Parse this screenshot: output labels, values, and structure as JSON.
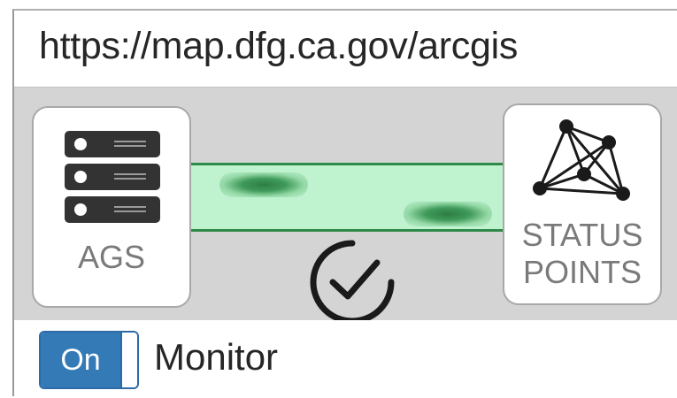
{
  "url_bar": {
    "text": "https://map.dfg.ca.gov/arcgis"
  },
  "diagram": {
    "source_node": {
      "label": "AGS",
      "icon": "server-stack-icon"
    },
    "target_node": {
      "label_line1": "STATUS",
      "label_line2": "POINTS",
      "icon": "network-graph-icon"
    },
    "connection_status_icon": "check-circle-icon",
    "colors": {
      "connection_fill": "#bff2cf",
      "connection_border": "#2f8a4a",
      "background": "#d4d4d4"
    }
  },
  "monitor": {
    "toggle_label": "On",
    "toggle_state": true,
    "label": "Monitor",
    "toggle_color": "#337ab7"
  }
}
